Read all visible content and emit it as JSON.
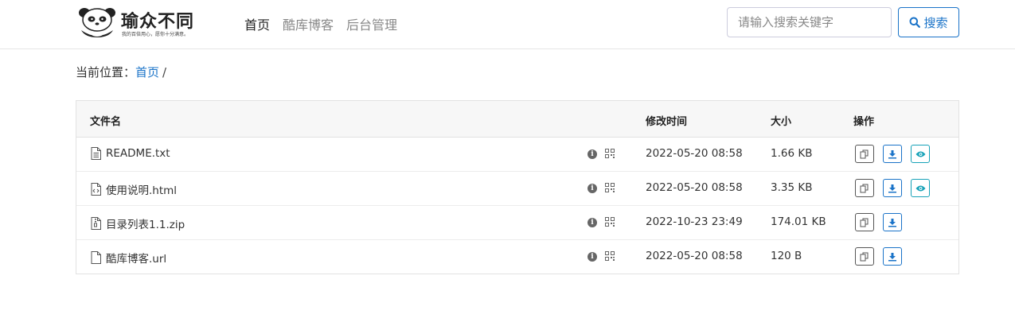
{
  "header": {
    "logo_name": "瑜众不同",
    "logo_slogan": "我的百倍用心，愿你十分满意。",
    "nav": [
      {
        "label": "首页",
        "active": true
      },
      {
        "label": "酷库博客",
        "active": false
      },
      {
        "label": "后台管理",
        "active": false
      }
    ],
    "search": {
      "placeholder": "请输入搜索关键字",
      "value": "",
      "button_label": "搜索",
      "button_icon": "search-icon"
    }
  },
  "breadcrumb": {
    "prefix": "当前位置：",
    "home": "首页",
    "separator": "/"
  },
  "table": {
    "columns": {
      "name": "文件名",
      "modified": "修改时间",
      "size": "大小",
      "actions": "操作"
    },
    "rows": [
      {
        "icon": "text-file-icon",
        "name": "README.txt",
        "modified": "2022-05-20 08:58",
        "size": "1.66 KB",
        "preview": true
      },
      {
        "icon": "code-file-icon",
        "name": "使用说明.html",
        "modified": "2022-05-20 08:58",
        "size": "3.35 KB",
        "preview": true
      },
      {
        "icon": "zip-file-icon",
        "name": "目录列表1.1.zip",
        "modified": "2022-10-23 23:49",
        "size": "174.01 KB",
        "preview": false
      },
      {
        "icon": "blank-file-icon",
        "name": "酷库博客.url",
        "modified": "2022-05-20 08:58",
        "size": "120 B",
        "preview": false
      }
    ]
  },
  "colors": {
    "accent": "#1a73c8",
    "preview": "#17a2b8",
    "header_bg": "#f7f7f7"
  }
}
